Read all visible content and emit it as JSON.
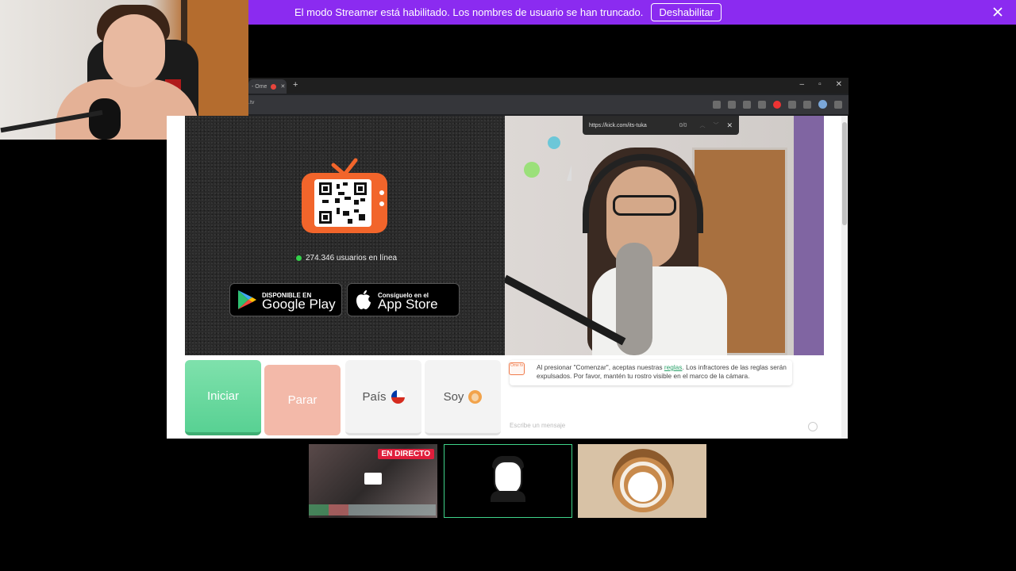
{
  "banner": {
    "message": "El modo Streamer está habilitado. Los nombres de usuario se han truncado.",
    "button": "Deshabilitar",
    "color": "#8b2bf0"
  },
  "browser": {
    "tab_title": "- Ome",
    "address": ".tv",
    "new_tab_icon": "plus-icon"
  },
  "findbar": {
    "query": "https://kick.com/its-tuka",
    "count": "0/0"
  },
  "left_panel": {
    "online_count": "274.346 usuarios en línea",
    "google_play": {
      "small": "DISPONIBLE EN",
      "big": "Google Play"
    },
    "app_store": {
      "small": "Consíguelo en el",
      "big": "App Store"
    }
  },
  "controls": {
    "start": "Iniciar",
    "stop": "Parar",
    "country": "País",
    "gender": "Soy",
    "start_color": "#58d193",
    "stop_color": "#f3b9a9"
  },
  "chat": {
    "notice_logo": "Ome tv",
    "notice_before": "Al presionar \"Comenzar\", aceptas nuestras ",
    "notice_link": "reglas",
    "notice_after": ". Los infractores de las reglas serán expulsados. Por favor, mantén tu rostro visible en el marco de la cámara.",
    "placeholder": "Escribe un mensaje"
  },
  "participants": {
    "live_badge": "EN DIRECTO"
  }
}
